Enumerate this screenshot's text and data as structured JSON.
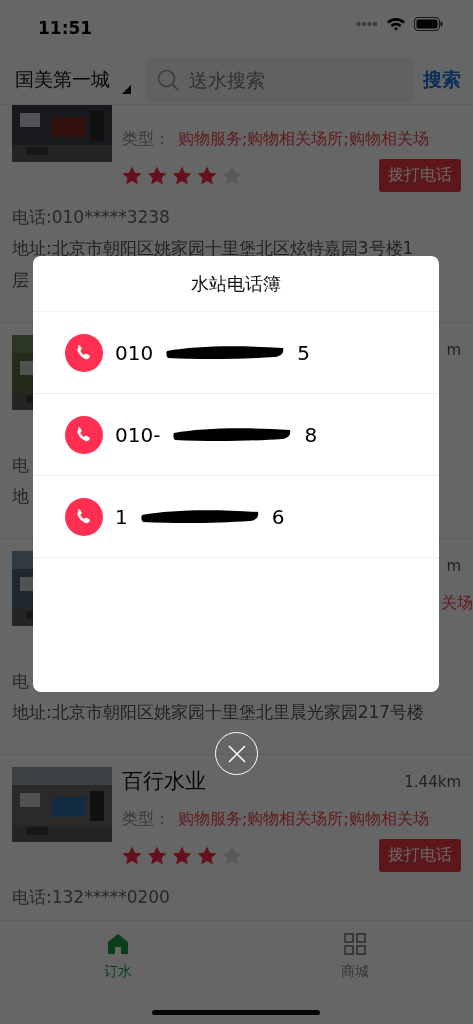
{
  "status_bar": {
    "time": "11:51"
  },
  "header": {
    "city": "国美第一城",
    "search": {
      "placeholder": "送水搜索"
    },
    "search_button": "搜索"
  },
  "stations": [
    {
      "photo": {
        "kind": "picture"
      },
      "type_label": "类型：",
      "type_value": "购物服务;购物相关场所;购物相关场",
      "stars": 4,
      "call_button": "拨打电话",
      "phone": "电话:010*****3238",
      "address": [
        "地址:北京市朝阳区姚家园十里堡北区炫特嘉园3号楼1",
        "层"
      ]
    },
    {
      "photo": {
        "kind": "picture"
      },
      "distance": "m",
      "phone": "电",
      "address": [
        "地"
      ]
    },
    {
      "photo": {
        "kind": "picture"
      },
      "distance": "m",
      "type_value": "关场",
      "phone": "电",
      "address": [
        "地址:北京市朝阳区姚家园十里堡北里晨光家园217号楼"
      ]
    },
    {
      "photo": {
        "kind": "picture"
      },
      "name": "百行水业",
      "distance": "1.44km",
      "type_label": "类型：",
      "type_value": "购物服务;购物相关场所;购物相关场",
      "stars": 4,
      "call_button": "拨打电话",
      "phone": "电话:132*****0200"
    }
  ],
  "tab_bar": [
    {
      "label": "订水",
      "selected": true
    },
    {
      "label": "商城",
      "selected": false
    }
  ],
  "dialog": {
    "title": "水站电话簿",
    "contacts": [
      {
        "number": "010",
        "redacted": true,
        "tail": "5"
      },
      {
        "number": "010-",
        "redacted": true,
        "tail": "8"
      },
      {
        "number": "1",
        "redacted": true,
        "tail": "6"
      }
    ],
    "dimmed": true
  }
}
